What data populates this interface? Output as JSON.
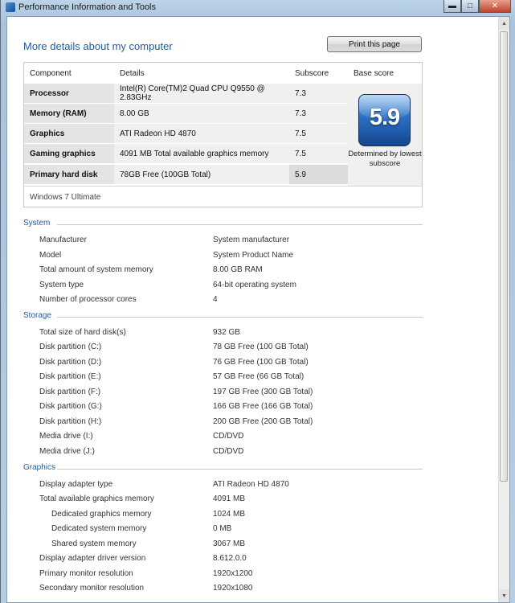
{
  "window": {
    "title": "Performance Information and Tools",
    "min_label": "▬",
    "max_label": "□",
    "close_label": "✕"
  },
  "page": {
    "heading": "More details about my computer",
    "print_button": "Print this page"
  },
  "score_table": {
    "headers": {
      "component": "Component",
      "details": "Details",
      "subscore": "Subscore",
      "base": "Base score"
    },
    "rows": [
      {
        "component": "Processor",
        "details": "Intel(R) Core(TM)2 Quad CPU Q9550 @ 2.83GHz",
        "subscore": "7.3"
      },
      {
        "component": "Memory (RAM)",
        "details": "8.00 GB",
        "subscore": "7.3"
      },
      {
        "component": "Graphics",
        "details": "ATI Radeon HD 4870",
        "subscore": "7.5"
      },
      {
        "component": "Gaming graphics",
        "details": "4091 MB Total available graphics memory",
        "subscore": "7.5"
      },
      {
        "component": "Primary hard disk",
        "details": "78GB Free (100GB Total)",
        "subscore": "5.9"
      }
    ],
    "base_score": "5.9",
    "base_note": "Determined by lowest subscore",
    "edition": "Windows 7 Ultimate"
  },
  "system": {
    "title": "System",
    "items": [
      {
        "label": "Manufacturer",
        "value": "System manufacturer"
      },
      {
        "label": "Model",
        "value": "System Product Name"
      },
      {
        "label": "Total amount of system memory",
        "value": "8.00 GB RAM"
      },
      {
        "label": "System type",
        "value": "64-bit operating system"
      },
      {
        "label": "Number of processor cores",
        "value": "4"
      }
    ]
  },
  "storage": {
    "title": "Storage",
    "items": [
      {
        "label": "Total size of hard disk(s)",
        "value": "932 GB"
      },
      {
        "label": "Disk partition (C:)",
        "value": "78 GB Free (100 GB Total)"
      },
      {
        "label": "Disk partition (D:)",
        "value": "76 GB Free (100 GB Total)"
      },
      {
        "label": "Disk partition (E:)",
        "value": "57 GB Free (66 GB Total)"
      },
      {
        "label": "Disk partition (F:)",
        "value": "197 GB Free (300 GB Total)"
      },
      {
        "label": "Disk partition (G:)",
        "value": "166 GB Free (166 GB Total)"
      },
      {
        "label": "Disk partition (H:)",
        "value": "200 GB Free (200 GB Total)"
      },
      {
        "label": "Media drive (I:)",
        "value": "CD/DVD"
      },
      {
        "label": "Media drive (J:)",
        "value": "CD/DVD"
      }
    ]
  },
  "graphics": {
    "title": "Graphics",
    "items": [
      {
        "label": "Display adapter type",
        "value": "ATI Radeon HD 4870"
      },
      {
        "label": "Total available graphics memory",
        "value": "4091 MB"
      },
      {
        "label": "Dedicated graphics memory",
        "value": "1024 MB"
      },
      {
        "label": "Dedicated system memory",
        "value": "0 MB"
      },
      {
        "label": "Shared system memory",
        "value": "3067 MB"
      },
      {
        "label": "Display adapter driver version",
        "value": "8.612.0.0"
      },
      {
        "label": "Primary monitor resolution",
        "value": "1920x1200"
      },
      {
        "label": "Secondary monitor resolution",
        "value": "1920x1080"
      }
    ]
  },
  "icons": {
    "scroll_up": "▲",
    "scroll_down": "▼"
  }
}
